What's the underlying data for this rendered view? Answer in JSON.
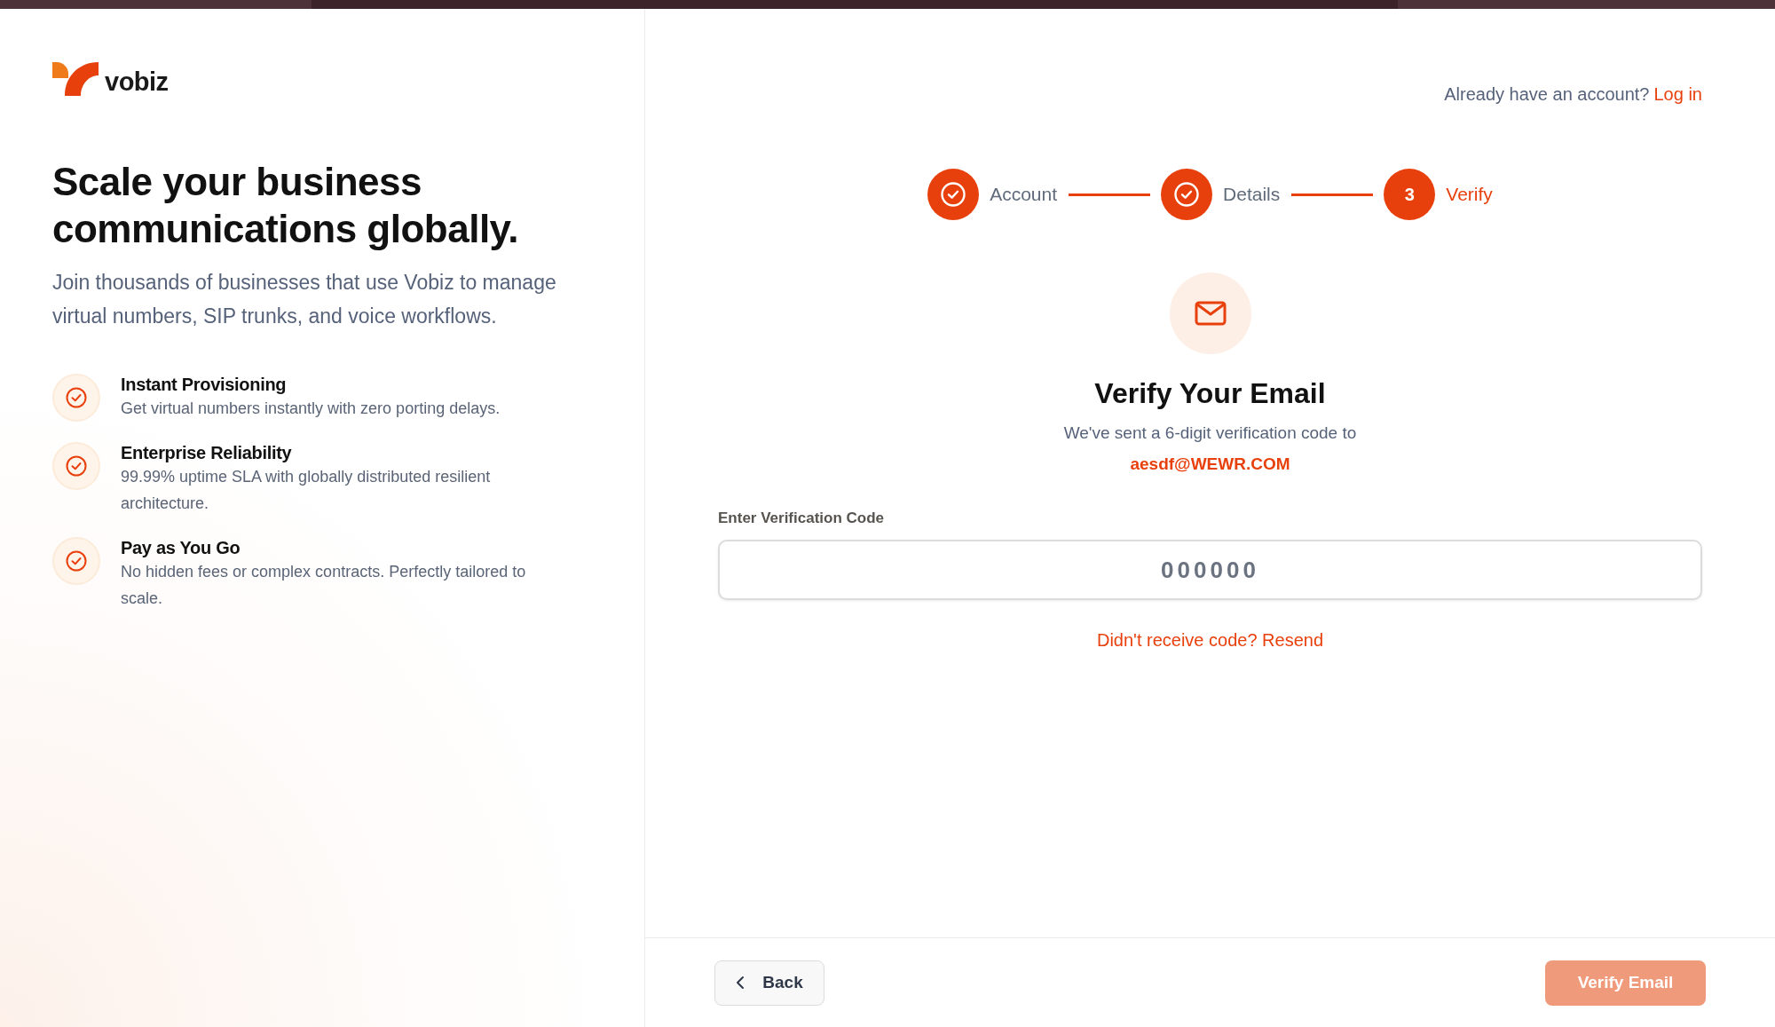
{
  "brand": {
    "name": "vobiz"
  },
  "hero": {
    "title": "Scale your business communications globally.",
    "subtitle": "Join thousands of businesses that use Vobiz to manage virtual numbers, SIP trunks, and voice workflows."
  },
  "features": [
    {
      "title": "Instant Provisioning",
      "description": "Get virtual numbers instantly with zero porting delays."
    },
    {
      "title": "Enterprise Reliability",
      "description": "99.99% uptime SLA with globally distributed resilient architecture."
    },
    {
      "title": "Pay as You Go",
      "description": "No hidden fees or complex contracts. Perfectly tailored to scale."
    }
  ],
  "login_prompt": {
    "text": "Already have an account?",
    "link": "Log in"
  },
  "steps": [
    {
      "label": "Account",
      "completed": true,
      "selected": false
    },
    {
      "label": "Details",
      "completed": true,
      "selected": false
    },
    {
      "label": "Verify",
      "number": "3",
      "completed": false,
      "selected": true
    }
  ],
  "verify": {
    "title": "Verify Your Email",
    "message": "We've sent a 6-digit verification code to",
    "email": "aesdf@WEWR.COM",
    "field_label": "Enter Verification Code",
    "placeholder": "000000",
    "resend": "Didn't receive code? Resend"
  },
  "footer": {
    "back": "Back",
    "submit": {
      "label": "Verify Email",
      "disabled": true
    }
  }
}
